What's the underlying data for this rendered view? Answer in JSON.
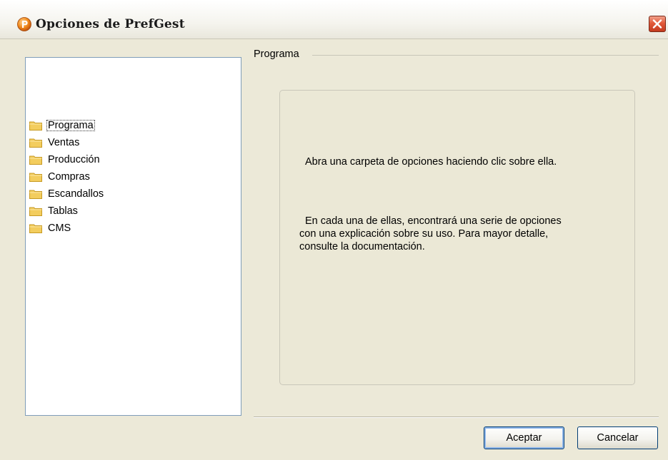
{
  "window": {
    "title": "Opciones de PrefGest",
    "app_icon": "prefgest-logo-icon",
    "close_icon": "close-icon"
  },
  "tree": {
    "items": [
      {
        "label": "Programa",
        "icon": "folder-icon",
        "selected": true
      },
      {
        "label": "Ventas",
        "icon": "folder-icon"
      },
      {
        "label": "Producción",
        "icon": "folder-icon"
      },
      {
        "label": "Compras",
        "icon": "folder-icon"
      },
      {
        "label": "Escandallos",
        "icon": "folder-icon"
      },
      {
        "label": "Tablas",
        "icon": "folder-icon"
      },
      {
        "label": "CMS",
        "icon": "folder-icon"
      }
    ]
  },
  "panel": {
    "group_title": "Programa",
    "message1": "Abra una carpeta de opciones haciendo clic sobre ella.",
    "message2_lines": [
      "En cada una de ellas, encontrará una serie de opciones",
      "con una explicación sobre su uso. Para mayor detalle,",
      "consulte la documentación."
    ]
  },
  "buttons": {
    "accept": "Aceptar",
    "cancel": "Cancelar"
  },
  "colors": {
    "window_bg": "#ece9d8",
    "close_red": "#e25a3a",
    "folder_yellow": "#f3cd5e",
    "tree_border": "#7f9db9",
    "button_border": "#003c74"
  }
}
